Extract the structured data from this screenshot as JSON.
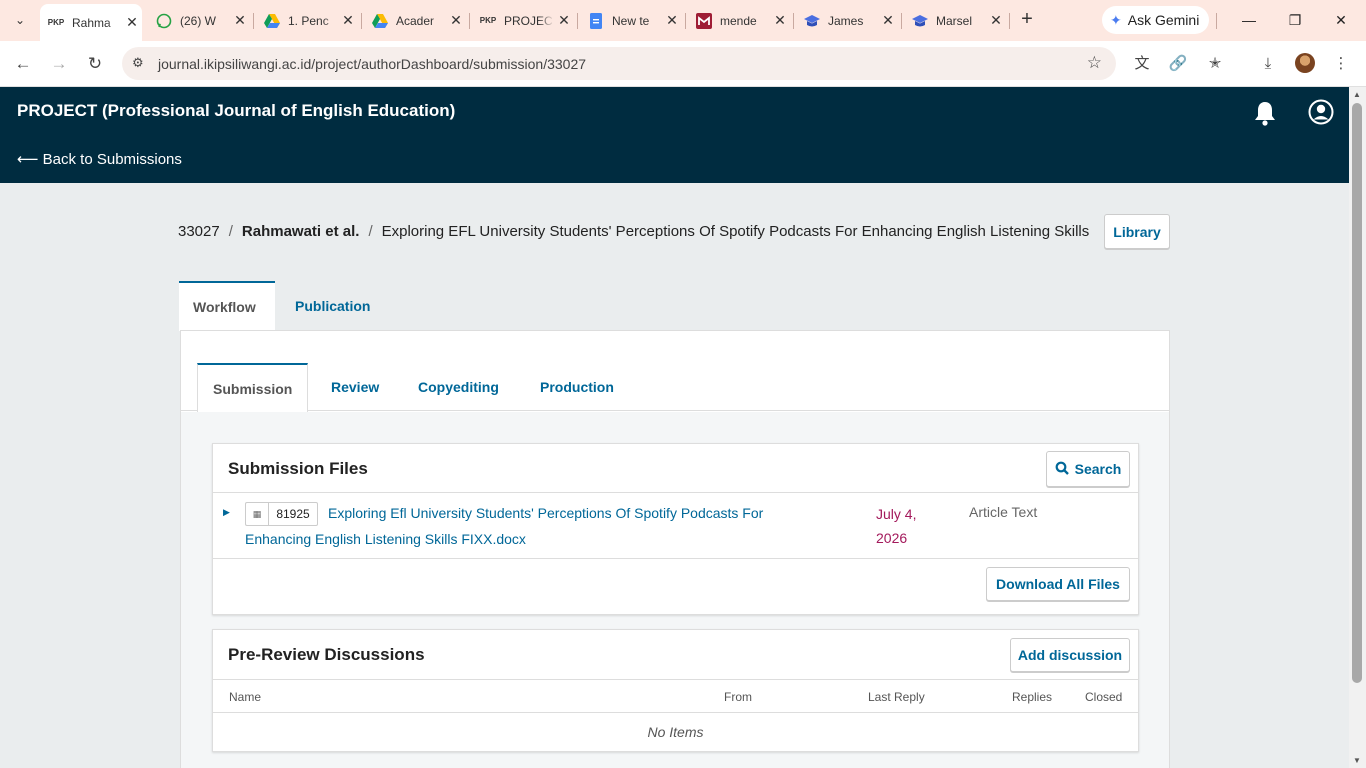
{
  "browser": {
    "tabs": [
      {
        "label": "Rahma",
        "favicon": "PKP",
        "active": true
      },
      {
        "label": "(26) W",
        "favicon": "whatsapp-icon"
      },
      {
        "label": "1. Penc",
        "favicon": "google-drive-icon"
      },
      {
        "label": "Acader",
        "favicon": "google-drive-icon"
      },
      {
        "label": "PROJEC",
        "favicon": "PKP"
      },
      {
        "label": "New te",
        "favicon": "google-docs-icon"
      },
      {
        "label": "mende",
        "favicon": "mendeley-icon"
      },
      {
        "label": "James",
        "favicon": "graduation-cap-icon"
      },
      {
        "label": "Marsel",
        "favicon": "graduation-cap-icon"
      }
    ],
    "ask_gemini": "Ask Gemini",
    "url": "journal.ikipsiliwangi.ac.id/project/authorDashboard/submission/33027"
  },
  "header": {
    "journal_title": "PROJECT (Professional Journal of English Education)",
    "back_link": "⟵ Back to Submissions"
  },
  "breadcrumb": {
    "id": "33027",
    "authors": "Rahmawati et al.",
    "title": "Exploring EFL University Students' Perceptions Of Spotify Podcasts For Enhancing English Listening Skills"
  },
  "library_button": "Library",
  "main_tabs": [
    "Workflow",
    "Publication"
  ],
  "sub_tabs": [
    "Submission",
    "Review",
    "Copyediting",
    "Production"
  ],
  "submission_files": {
    "title": "Submission Files",
    "search_label": "Search",
    "files": [
      {
        "id": "81925",
        "name": "Exploring Efl University Students' Perceptions Of Spotify Podcasts For Enhancing English Listening Skills FIXX.docx",
        "date": "July 4, 2026",
        "type": "Article Text"
      }
    ],
    "download_all_label": "Download All Files"
  },
  "pre_review": {
    "title": "Pre-Review Discussions",
    "add_label": "Add discussion",
    "columns": [
      "Name",
      "From",
      "Last Reply",
      "Replies",
      "Closed"
    ],
    "empty": "No Items"
  },
  "colors": {
    "header_bg": "#002c40",
    "link": "#006798",
    "date": "#a3195b",
    "tabstrip": "#fde8e1"
  }
}
